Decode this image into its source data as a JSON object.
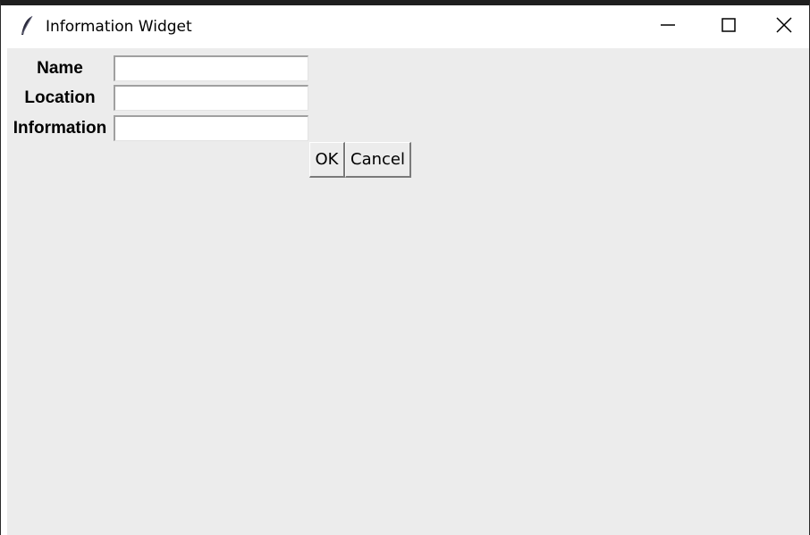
{
  "window": {
    "title": "Information Widget",
    "app_icon": "feather-icon",
    "controls": {
      "minimize_icon": "minimize-icon",
      "maximize_icon": "maximize-icon",
      "close_icon": "close-icon"
    }
  },
  "form": {
    "fields": [
      {
        "label": "Name",
        "value": ""
      },
      {
        "label": "Location",
        "value": ""
      },
      {
        "label": "Information",
        "value": ""
      }
    ],
    "ok_label": "OK",
    "cancel_label": "Cancel"
  },
  "colors": {
    "client_background": "#ececec",
    "entry_background": "#ffffff",
    "titlebar_background": "#ffffff"
  }
}
